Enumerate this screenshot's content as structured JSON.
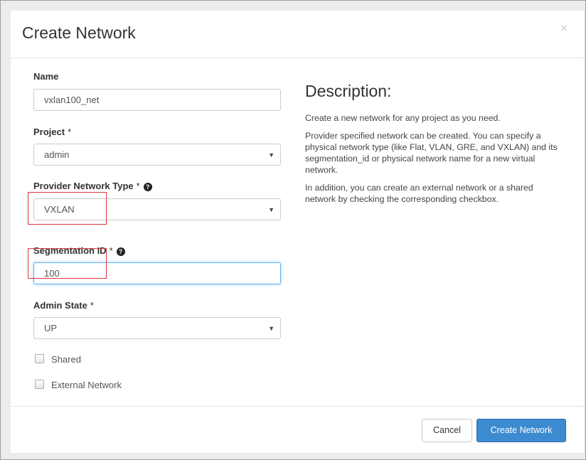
{
  "modal": {
    "title": "Create Network",
    "close_label": "×"
  },
  "form": {
    "name": {
      "label": "Name",
      "value": "vxlan100_net"
    },
    "project": {
      "label": "Project",
      "required_mark": "*",
      "value": "admin"
    },
    "provider_network_type": {
      "label": "Provider Network Type",
      "required_mark": "*",
      "help_icon": "?",
      "value": "VXLAN"
    },
    "segmentation_id": {
      "label": "Segmentation ID",
      "required_mark": "*",
      "help_icon": "?",
      "value": "100"
    },
    "admin_state": {
      "label": "Admin State",
      "required_mark": "*",
      "value": "UP"
    },
    "shared": {
      "label": "Shared",
      "checked": false
    },
    "external_network": {
      "label": "External Network",
      "checked": false
    },
    "dropdown_caret": "▼"
  },
  "description": {
    "title": "Description:",
    "paragraphs": [
      "Create a new network for any project as you need.",
      "Provider specified network can be created. You can specify a physical network type (like Flat, VLAN, GRE, and VXLAN) and its segmentation_id or physical network name for a new virtual network.",
      "In addition, you can create an external network or a shared network by checking the corresponding checkbox."
    ]
  },
  "footer": {
    "cancel_label": "Cancel",
    "submit_label": "Create Network"
  },
  "colors": {
    "primary": "#3c8bd0",
    "highlight_box": "#e0353d",
    "focus_border": "#66afe9"
  }
}
